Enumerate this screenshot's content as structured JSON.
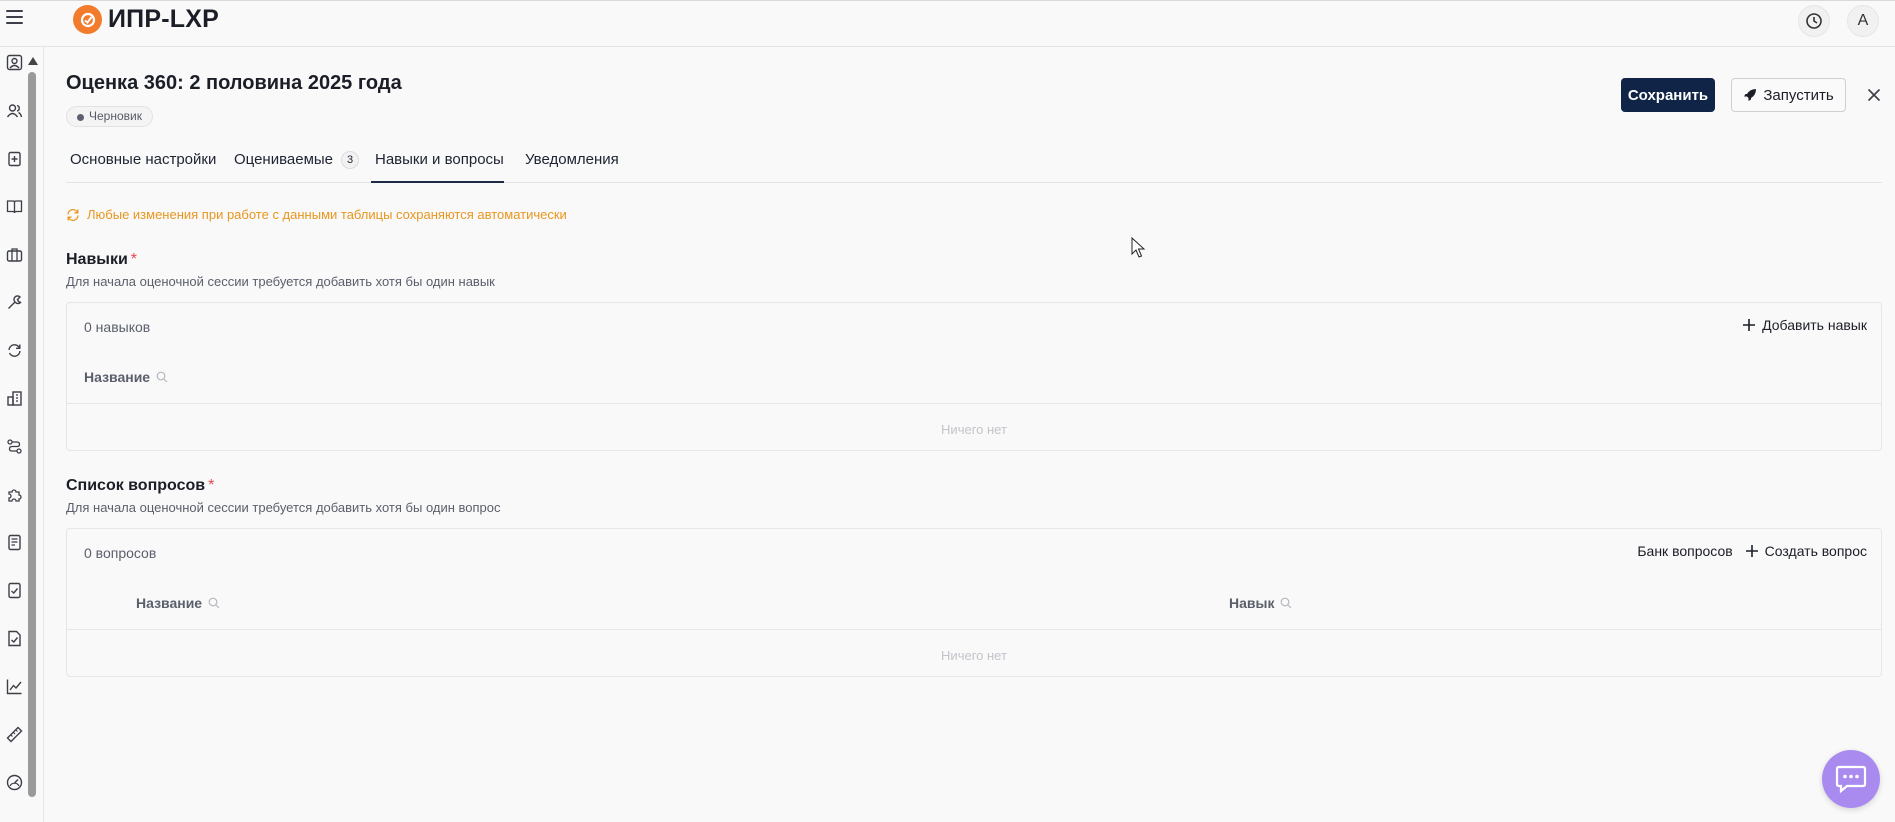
{
  "app": {
    "name": "ИПР-LXP",
    "user_initial": "А"
  },
  "colors": {
    "accent": "#0f2446",
    "brand": "#f27c2c",
    "warning": "#e8961e",
    "required": "#e5484d",
    "chat": "#a98bf0"
  },
  "sidebar": {
    "icons": [
      "profile-icon",
      "users-icon",
      "clipboard-add-icon",
      "book-icon",
      "briefcase-icon",
      "wrench-icon",
      "refresh-icon",
      "buildings-icon",
      "route-icon",
      "puzzle-icon",
      "document-list-icon",
      "document-check-icon",
      "file-check-icon",
      "line-chart-icon",
      "ruler-icon",
      "gauge-icon"
    ]
  },
  "page": {
    "title": "Оценка 360: 2 половина 2025 года",
    "status": "Черновик",
    "save_label": "Сохранить",
    "launch_label": "Запустить"
  },
  "tabs": [
    {
      "label": "Основные настройки"
    },
    {
      "label": "Оцениваемые",
      "count": "3"
    },
    {
      "label": "Навыки и вопросы",
      "active": true
    },
    {
      "label": "Уведомления"
    }
  ],
  "autosave_notice": "Любые изменения при работе с данными таблицы сохраняются автоматически",
  "skills": {
    "title": "Навыки",
    "required_mark": "*",
    "hint": "Для начала оценочной сессии требуется добавить хотя бы один навык",
    "count": "0 навыков",
    "add_label": "Добавить навык",
    "columns": [
      "Название"
    ],
    "empty": "Ничего нет"
  },
  "questions": {
    "title": "Список вопросов",
    "required_mark": "*",
    "hint": "Для начала оценочной сессии требуется добавить хотя бы один вопрос",
    "count": "0 вопросов",
    "bank_label": "Банк вопросов",
    "create_label": "Создать вопрос",
    "columns": [
      "Название",
      "Навык"
    ],
    "empty": "Ничего нет"
  }
}
